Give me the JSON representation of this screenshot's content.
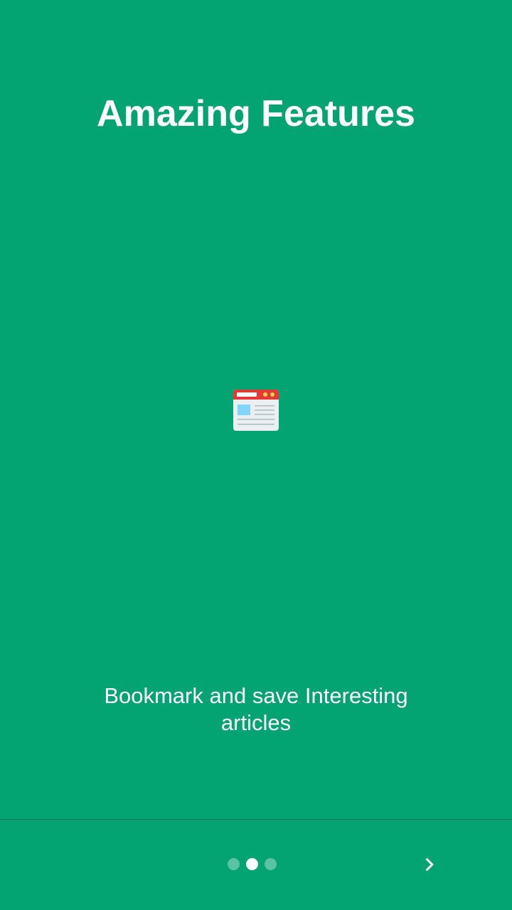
{
  "slide": {
    "title": "Amazing Features",
    "description": "Bookmark and save Interesting articles",
    "illustration_icon": "browser-window-icon"
  },
  "pager": {
    "total_pages": 3,
    "current_page": 2,
    "next_icon": "chevron-right-icon"
  },
  "colors": {
    "background": "#03A472",
    "text": "#FFFFFF",
    "divider": "#0E6E4C",
    "dot_inactive": "rgba(255,255,255,0.35)",
    "dot_active": "#FFFFFF",
    "browser_header": "#E53935",
    "browser_body": "#ECEFF1",
    "image_block": "#81D4FA",
    "header_dots": "#FFD54F"
  }
}
